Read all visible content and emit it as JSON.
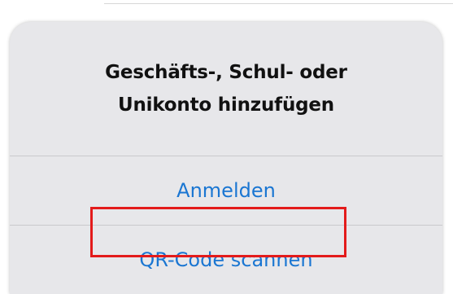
{
  "dialog": {
    "title_lines": [
      "Geschäfts-, Schul- oder",
      "Unikonto hinzufügen"
    ],
    "actions": [
      {
        "label": "Anmelden"
      },
      {
        "label": "QR-Code scannen"
      }
    ]
  },
  "colors": {
    "action_text": "#1a76d2",
    "highlight_border": "#e31b1b",
    "sheet_background": "#e7e7ea"
  }
}
